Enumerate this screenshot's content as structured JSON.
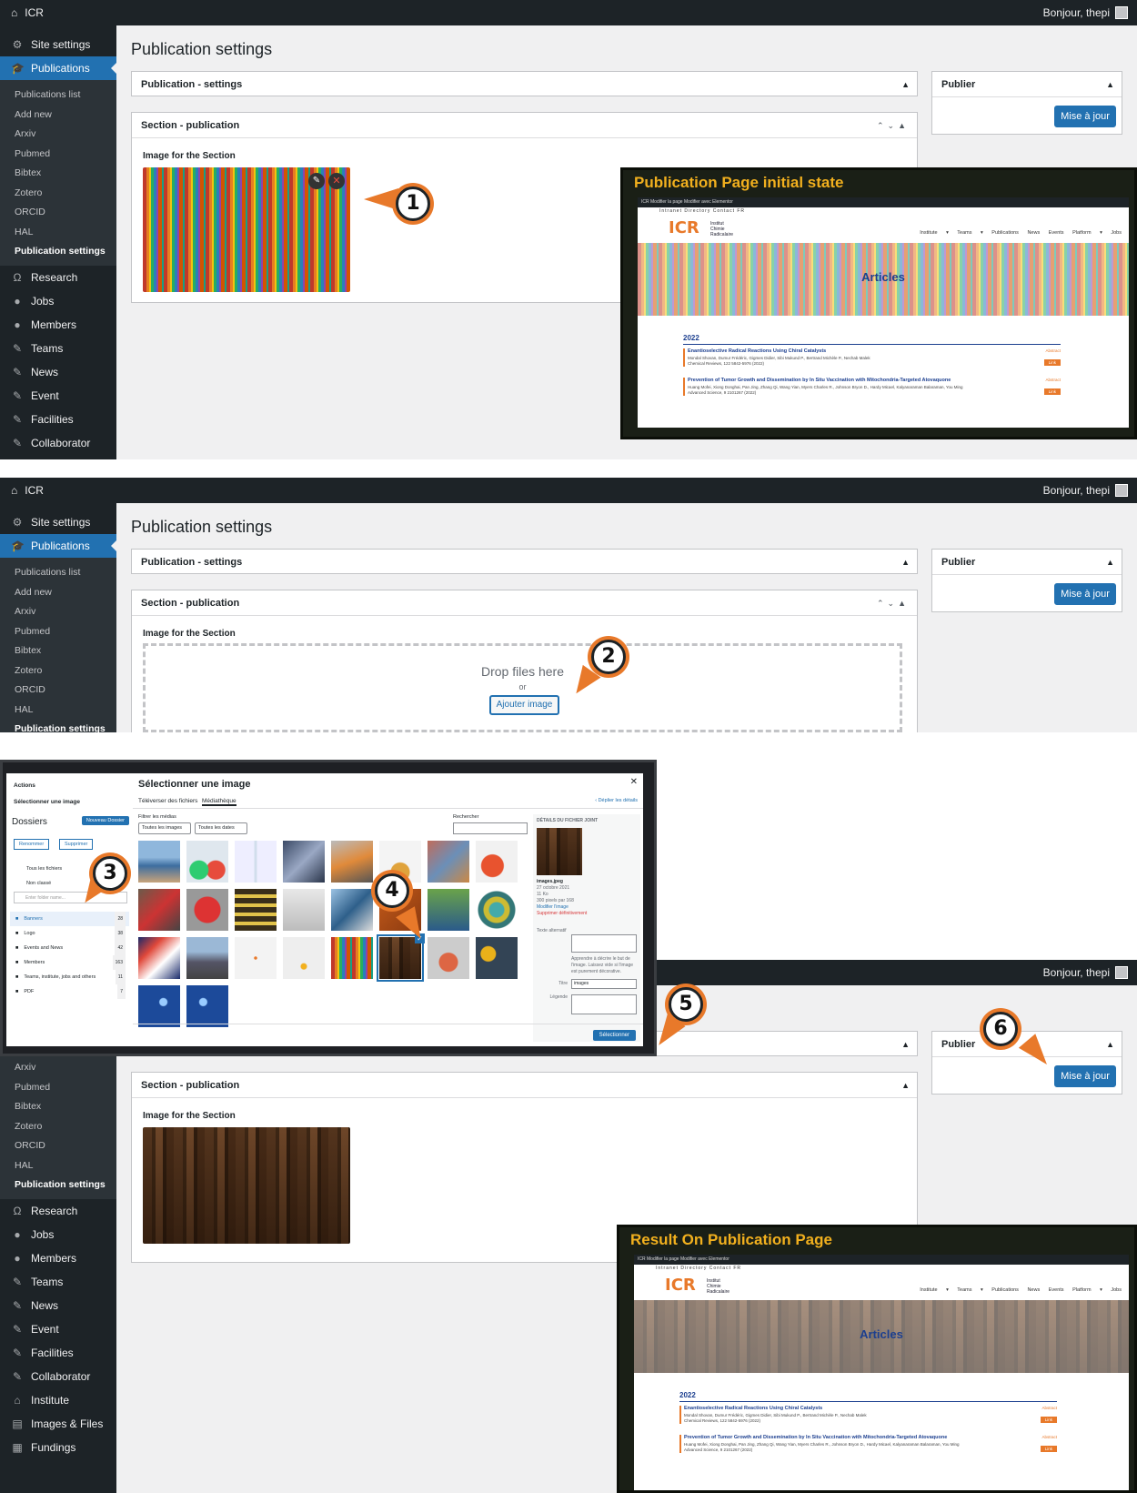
{
  "adminbar": {
    "site": "ICR",
    "hello": "Bonjour, thepi"
  },
  "menu": {
    "site_settings": "Site settings",
    "publications": "Publications",
    "sub": [
      "Publications list",
      "Add new",
      "Arxiv",
      "Pubmed",
      "Bibtex",
      "Zotero",
      "ORCID",
      "HAL",
      "Publication settings"
    ],
    "items": [
      "Research",
      "Jobs",
      "Members",
      "Teams",
      "News",
      "Event",
      "Facilities",
      "Collaborator",
      "Institute",
      "Images & Files",
      "Fundings"
    ]
  },
  "page": {
    "title": "Publication settings",
    "box_settings": "Publication - settings",
    "box_section": "Section - publication",
    "image_label": "Image for the Section",
    "publish_title": "Publier",
    "update_button": "Mise à jour",
    "drop_text": "Drop files here",
    "drop_or": "or",
    "add_image": "Ajouter image"
  },
  "callouts": [
    "1",
    "2",
    "3",
    "4",
    "5",
    "6"
  ],
  "shot1": {
    "title": "Publication Page initial state"
  },
  "shot2": {
    "title": "Result On Publication Page"
  },
  "mini": {
    "topbar": "ICR   Modifier la page   Modifier avec Elementor",
    "toplinks": "Intranet   Directory   Contact   FR",
    "logo": "ICR",
    "logo_text": [
      "Institut",
      "Chimie",
      "Radicalaire"
    ],
    "nav": "Institute ▾  Teams ▾  Publications  News  Events  Platform ▾  Jobs",
    "banner": "Articles",
    "year": "2022",
    "pubs": [
      {
        "title": "Enantioselective Radical Reactions Using Chiral Catalysts",
        "authors": "Mondal Shovan, Dumur Frédéric, Gigmes Didier, Sibi Mukund P., Bertrand Michèle P., Nechab Malek",
        "journal": "Chemical Reviews, 122 5842-5976 (2022)"
      },
      {
        "title": "Prevention of Tumor Growth and Dissemination by In Situ Vaccination with Mitochondria-Targeted Atovaquone",
        "authors": "Huang Mofei, Xiong Donghai, Pan Jing, Zhang Qi, Wang Yian, Myers Charles R., Johnson Bryon D., Hardy Micael, Kalyanaraman Balaraman, You Ming",
        "journal": "Advanced Science, 9 2101267 (2022)"
      }
    ],
    "abstract": "Abstract",
    "link": "Link"
  },
  "modal": {
    "actions": "Actions",
    "select_image": "Sélectionner une image",
    "folders": "Dossiers",
    "new_folder": "Nouveau Dossier",
    "rename": "Renommer",
    "delete": "Supprimer",
    "all_files": "Tous les fichiers",
    "unclassified": "Non classé",
    "folder_placeholder": "Enter folder name...",
    "folder_list": [
      {
        "name": "Banners",
        "count": "28"
      },
      {
        "name": "Logo",
        "count": "38"
      },
      {
        "name": "Events and News",
        "count": "42"
      },
      {
        "name": "Members",
        "count": "163"
      },
      {
        "name": "Teams, institute, jobs and others",
        "count": "11"
      },
      {
        "name": "PDF",
        "count": "7"
      }
    ],
    "title": "Sélectionner une image",
    "tab_upload": "Téléverser des fichiers",
    "tab_library": "Médiathèque",
    "unfold": "‹ Déplier les détails",
    "filter_label": "Filtrer les médias",
    "filter_images": "Toutes les images",
    "filter_dates": "Toutes les dates",
    "search_label": "Rechercher",
    "details_title": "DÉTAILS DU FICHIER JOINT",
    "file_name": "images.jpeg",
    "file_date": "27 octobre 2021",
    "file_size": "11 Ko",
    "file_dims": "300 pixels par 168",
    "edit_image": "Modifier l'image",
    "delete_perm": "Supprimer définitivement",
    "alt_label": "Texte alternatif",
    "alt_help": "Apprendre à décrire le but de l'image. Laissez vide si l'image est purement décorative.",
    "title_label": "Titre",
    "title_value": "images",
    "caption_label": "Légende",
    "select_button": "Sélectionner"
  }
}
